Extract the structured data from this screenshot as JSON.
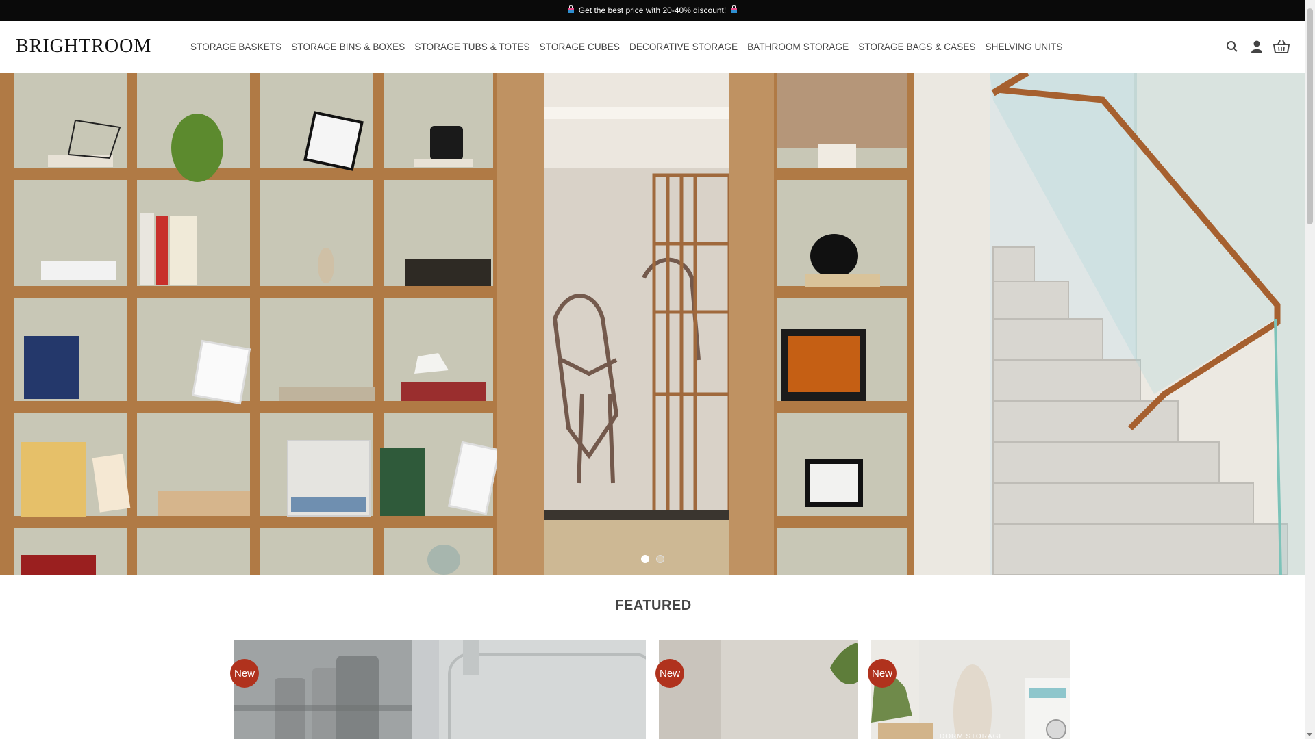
{
  "promo": {
    "text": "Get the best price with 20-40% discount!",
    "icon": "shopping-bag-icon"
  },
  "header": {
    "logo": "BRIGHTROOM",
    "nav": [
      "STORAGE BASKETS",
      "STORAGE BINS & BOXES",
      "STORAGE TUBS & TOTES",
      "STORAGE CUBES",
      "DECORATIVE STORAGE",
      "BATHROOM STORAGE",
      "STORAGE BAGS & CASES",
      "SHELVING UNITS"
    ],
    "icons": [
      "search-icon",
      "account-icon",
      "cart-basket-icon"
    ]
  },
  "hero": {
    "slides": 2,
    "active_slide": 1
  },
  "featured": {
    "title": "FEATURED",
    "cards": [
      {
        "badge": "New",
        "label": ""
      },
      {
        "badge": "New",
        "label": ""
      },
      {
        "badge": "New",
        "label": "DORM STORAGE"
      }
    ]
  },
  "colors": {
    "promo_bg": "#0a0a0a",
    "badge": "#b0321d",
    "shelf_wood": "#b07a45"
  }
}
